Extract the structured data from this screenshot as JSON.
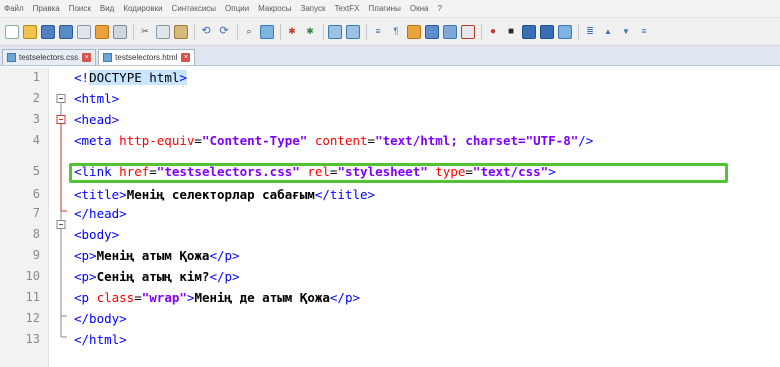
{
  "menu": [
    "Файл",
    "Правка",
    "Поиск",
    "Вид",
    "Кодировки",
    "Синтаксисы",
    "Опции",
    "Макросы",
    "Запуск",
    "TextFX",
    "Плагины",
    "Окна",
    "?"
  ],
  "tabs": [
    {
      "label": "testselectors.css",
      "active": false
    },
    {
      "label": "testselectors.html",
      "active": true
    }
  ],
  "line_numbers": [
    "1",
    "2",
    "3",
    "4",
    "5",
    "6",
    "7",
    "8",
    "9",
    "10",
    "11",
    "12",
    "13"
  ],
  "code": {
    "l1_open": "<!",
    "l1_doctype": "DOCTYPE html",
    "l1_close": ">",
    "l2": "<html>",
    "l3": "<head>",
    "l4_open": "<meta ",
    "l4_attr1": "http-equiv",
    "l4_eq": "=",
    "l4_val1": "\"Content-Type\"",
    "l4_attr2": " content",
    "l4_val2": "\"text/html; charset=\"UTF-8\"",
    "l4_close": "/>",
    "l5_open": "<link ",
    "l5_attr1": "href",
    "l5_val1": "\"testselectors.css\"",
    "l5_attr2": " rel",
    "l5_val2": "\"stylesheet\"",
    "l5_attr3": " type",
    "l5_val3": "\"text/css\"",
    "l5_close": ">",
    "l6_open": "<title>",
    "l6_text": "Менің селекторлар сабағым",
    "l6_close": "</title>",
    "l7": "</head>",
    "l8": "<body>",
    "l9_open": "<p>",
    "l9_text": "Менің атым Қожа",
    "l9_close": "</p>",
    "l10_open": "<p>",
    "l10_text": "Сенің атың кім?",
    "l10_close": "</p>",
    "l11_open": "<p ",
    "l11_attr": "class",
    "l11_val": "\"wrap\"",
    "l11_gt": ">",
    "l11_text": "Менің де атым Қожа",
    "l11_close": "</p>",
    "l12": "</body>",
    "l13": "</html>"
  },
  "colors": {
    "tag": "#0000ff",
    "attribute": "#ff0000",
    "value": "#8000ff",
    "highlight_box": "#52c433"
  },
  "toolbar_icons": [
    "new-file-icon",
    "open-file-icon",
    "save-icon",
    "save-all-icon",
    "close-icon",
    "close-all-icon",
    "print-icon",
    "cut-icon",
    "copy-icon",
    "paste-icon",
    "undo-icon",
    "redo-icon",
    "find-icon",
    "replace-icon",
    "zoom-in-icon",
    "zoom-out-icon",
    "sync-v-icon",
    "sync-h-icon",
    "word-wrap-icon",
    "show-all-icon",
    "indent-guide-icon",
    "udl-icon",
    "doc-map-icon",
    "function-list-icon",
    "record-macro-icon",
    "stop-macro-icon",
    "play-macro-icon",
    "run-macro-icon",
    "save-macro-icon",
    "spell-icon",
    "up-icon",
    "down-icon",
    "more-icon"
  ]
}
